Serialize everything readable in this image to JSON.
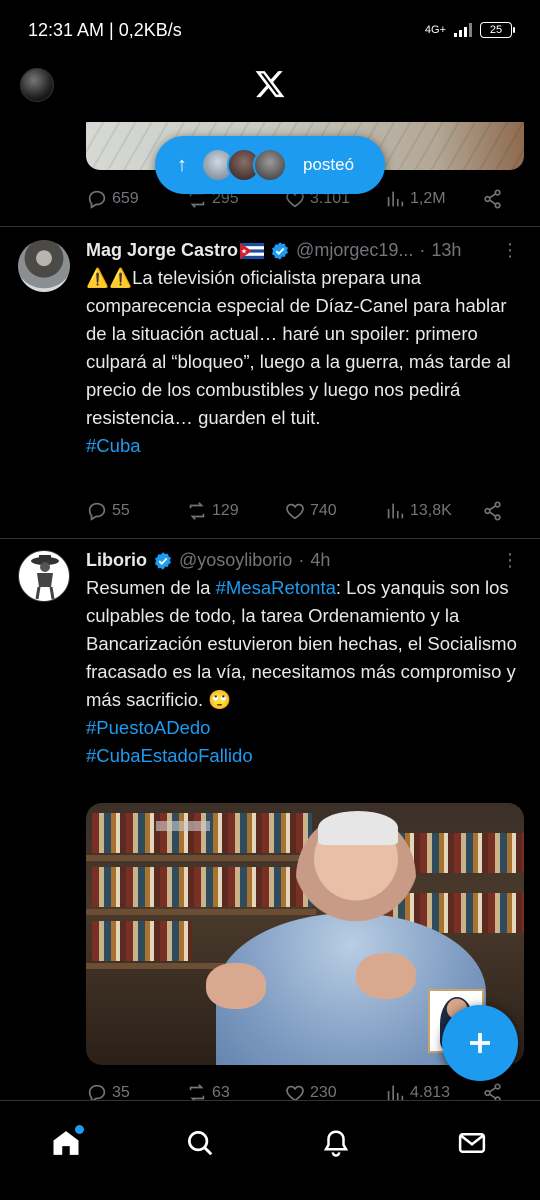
{
  "status_bar": {
    "time": "12:31 AM | 0,2KB/s",
    "network": "4G+",
    "battery": "25"
  },
  "new_posts_pill": {
    "label": "posteó"
  },
  "tweet0_actions": {
    "replies": "659",
    "reposts": "295",
    "likes": "3.101",
    "views": "1,2M"
  },
  "tweets": [
    {
      "name": "Mag Jorge Castro",
      "handle": "@mjorgec19...",
      "time": "13h",
      "text": "⚠️⚠️La televisión oficialista prepara una comparecencia especial de Díaz-Canel para hablar de la situación actual… haré un spoiler: primero culpará al “bloqueo”, luego a la guerra, más tarde al precio de los combustibles y luego nos pedirá resistencia… guarden el tuit.",
      "hashtag": "#Cuba",
      "replies": "55",
      "reposts": "129",
      "likes": "740",
      "views": "13,8K"
    },
    {
      "name": "Liborio",
      "handle": "@yosoyliborio",
      "time": "4h",
      "text_pre": "Resumen de la ",
      "text_tag": "#MesaRetonta",
      "text_post": ": Los yanquis son los culpables de todo, la tarea Ordenamiento y la Bancarización estuvieron bien hechas, el Socialismo fracasado es la vía, necesitamos más compromiso y más sacrificio. 🙄",
      "hashtags": [
        "#PuestoADedo",
        "#CubaEstadoFallido"
      ],
      "replies": "35",
      "reposts": "63",
      "likes": "230",
      "views": "4.813"
    }
  ],
  "colors": {
    "accent": "#1d9bf0",
    "background": "#000000",
    "muted": "#71767b",
    "divider": "#2f3336"
  },
  "icons": [
    "x-logo",
    "verified-badge-icon",
    "reply-icon",
    "repost-icon",
    "like-icon",
    "views-icon",
    "share-icon",
    "more-icon",
    "compose-icon",
    "home-icon",
    "search-icon",
    "notifications-icon",
    "messages-icon"
  ]
}
